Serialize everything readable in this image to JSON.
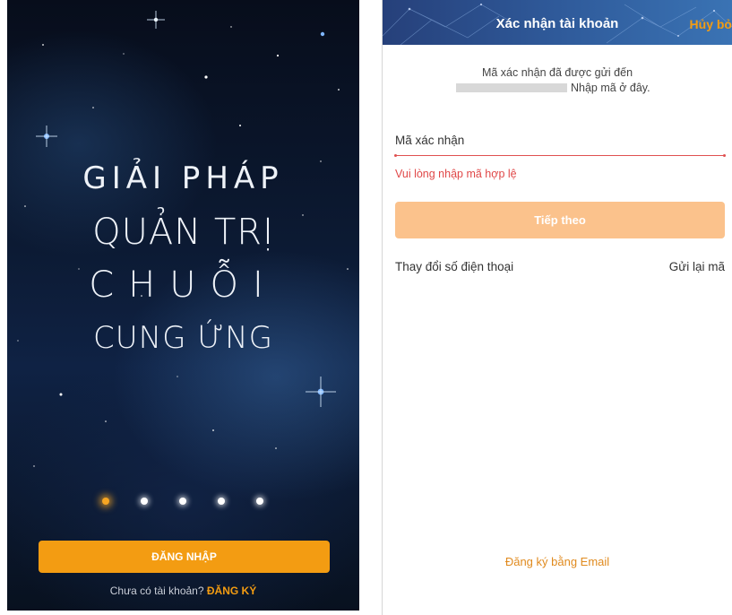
{
  "onboarding": {
    "headline": {
      "line1": "GIẢI PHÁP",
      "line2": "QUẢN TRỊ",
      "line3": "CHUỖI",
      "line4": "CUNG ỨNG"
    },
    "carousel": {
      "total_pages": 5,
      "active_page": 1
    },
    "login_label": "ĐĂNG NHẬP",
    "no_account_text": "Chưa có tài khoản?",
    "register_label": "ĐĂNG KÝ"
  },
  "verify": {
    "title": "Xác nhận tài khoản",
    "cancel_label": "Hủy bỏ",
    "info_line1": "Mã xác nhận đã được gửi đến",
    "info_line2_suffix": "Nhập mã ở đây.",
    "code_label": "Mã xác nhận",
    "code_value": "",
    "error_text": "Vui lòng nhập mã hợp lệ",
    "next_label": "Tiếp theo",
    "change_phone_label": "Thay đổi số điện thoại",
    "resend_label": "Gửi lại mã",
    "email_register_label": "Đăng ký bằng Email"
  },
  "colors": {
    "accent": "#f39c12",
    "error": "#e04848",
    "disabled_button": "#fbc28c",
    "nav_bar": "#2f5a9a"
  }
}
